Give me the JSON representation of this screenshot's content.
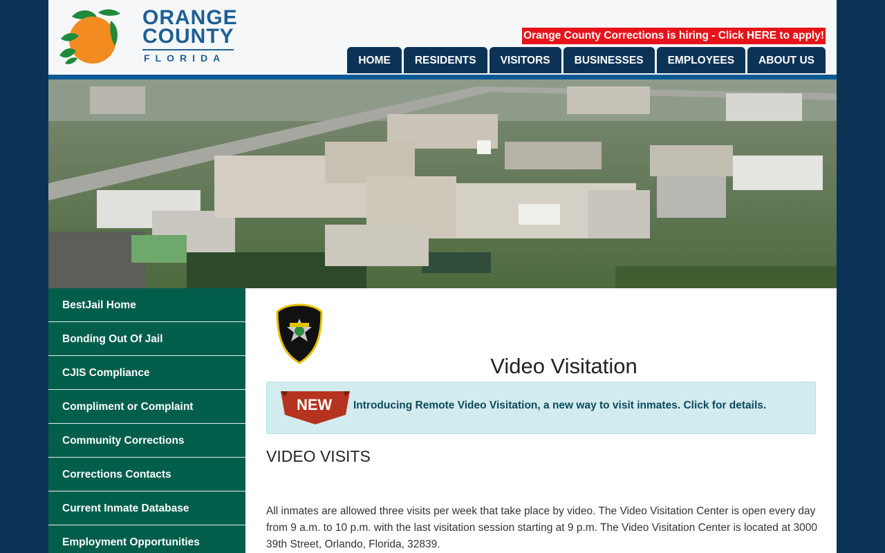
{
  "header": {
    "logo_line1": "ORANGE",
    "logo_line2": "COUNTY",
    "logo_line3": "FLORIDA",
    "hiring_banner": "Orange County Corrections is hiring - Click HERE to apply!",
    "nav": [
      "HOME",
      "RESIDENTS",
      "VISITORS",
      "BUSINESSES",
      "EMPLOYEES",
      "ABOUT US"
    ]
  },
  "sidebar": {
    "items": [
      "BestJail Home",
      "Bonding Out Of Jail",
      "CJIS Compliance",
      "Compliment or Complaint",
      "Community Corrections",
      "Corrections Contacts",
      "Current Inmate Database",
      "Employment Opportunities"
    ]
  },
  "main": {
    "page_title": "Video Visitation",
    "alert_badge": "NEW",
    "alert_text": "Introducing Remote Video Visitation, a new way to visit inmates. Click for details.",
    "section_heading": "VIDEO VISITS",
    "paragraph": "All inmates are allowed three visits per week that take place by video. The Video Visitation Center is open every day from 9 a.m. to 10 p.m. with the last visitation session starting at 9 p.m. The Video Visitation Center is located at 3000 39th Street, Orlando, Florida, 32839."
  },
  "colors": {
    "page_bg": "#0c3356",
    "nav_bg": "#0c3356",
    "sidebar_bg": "#005e4a",
    "hiring_bg": "#e8131a",
    "alert_bg": "#d2ebef",
    "brand_blue": "#1d5f95"
  },
  "icons": {
    "logo": "orange-fruit-logo",
    "badge": "corrections-department-badge",
    "ribbon": "new-ribbon"
  }
}
